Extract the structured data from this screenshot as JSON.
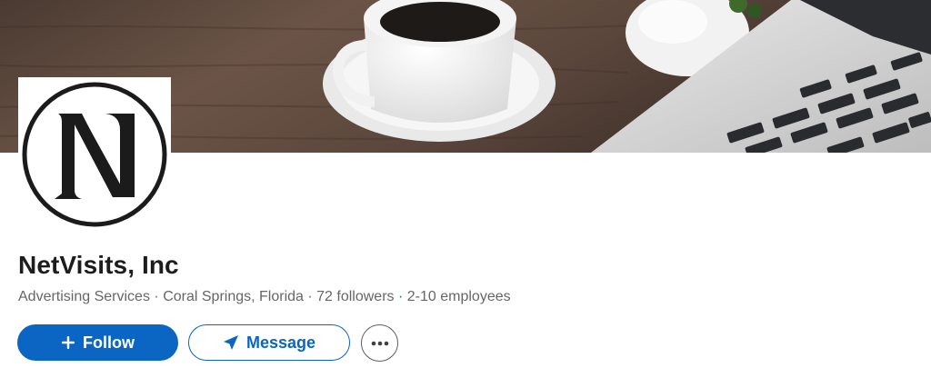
{
  "company": {
    "name": "NetVisits, Inc"
  },
  "meta": {
    "industry": "Advertising Services",
    "separator": "·",
    "location": "Coral Springs, Florida",
    "followers": "72 followers",
    "employees": "2-10 employees"
  },
  "actions": {
    "follow_label": "Follow",
    "message_label": "Message"
  },
  "icons": {
    "follow": "plus-icon",
    "message": "paper-plane-icon",
    "more": "ellipsis-icon",
    "logo": "netvisits-n-logo"
  },
  "colors": {
    "primary": "#0a66c2",
    "text": "#1d1d1d",
    "muted": "#666666"
  }
}
